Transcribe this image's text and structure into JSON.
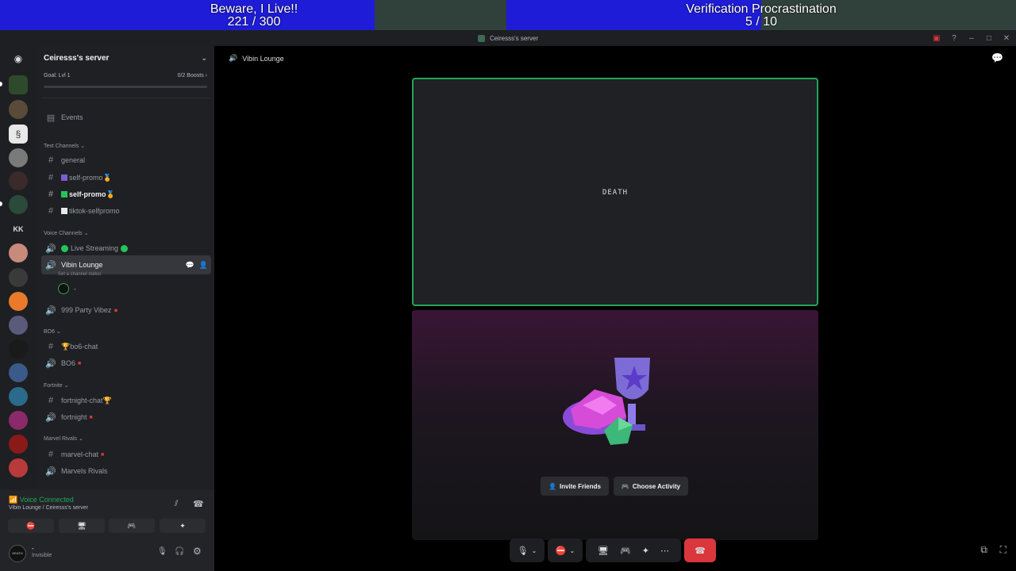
{
  "goals": [
    {
      "title": "Beware, I Live!!",
      "progress": "221 / 300",
      "fraction": 0.7367
    },
    {
      "title": "Verification Procrastination",
      "progress": "5 / 10",
      "fraction": 0.5
    }
  ],
  "window": {
    "title": "Ceiresss's server"
  },
  "server": {
    "name": "Ceiresss's server",
    "goal_label": "Goal: Lvl 1",
    "boosts": "0/2 Boosts",
    "events": "Events"
  },
  "categories": {
    "text": "Text Channels",
    "voice": "Voice Channels",
    "bo6": "BO6",
    "fortnite": "Fortnite",
    "marvel": "Marvel Rivals"
  },
  "channels": {
    "general": "general",
    "self_promo_1": "self-promo",
    "self_promo_2": "self-promo",
    "tiktok": "tiktok-selfpromo",
    "live_streaming": "Live Streaming",
    "vibin_lounge": "Vibin Lounge",
    "vibin_status": "Set a channel status",
    "party": "999 Party Vibez",
    "bo6_chat": "bo6-chat",
    "bo6_voice": "BO6",
    "fortnite_chat": "fortnight-chat",
    "fortnite_voice": "fortnight",
    "marvel_chat": "marvel-chat",
    "marvel_voice": "Marvels Rivals",
    "voice_user": "-"
  },
  "voice_panel": {
    "status": "Voice Connected",
    "location": "Vibin Lounge / Ceiresss's server"
  },
  "user": {
    "name": "-",
    "status": "Invisible",
    "avatar_text": "DEATH"
  },
  "main": {
    "channel_title": "Vibin Lounge",
    "tile_label": "DEATH",
    "invite_label": "Invite Friends",
    "activity_label": "Choose Activity"
  },
  "colors": {
    "accent_green": "#23a55a",
    "goal_fill": "#1f1cd8",
    "danger": "#da373c"
  }
}
